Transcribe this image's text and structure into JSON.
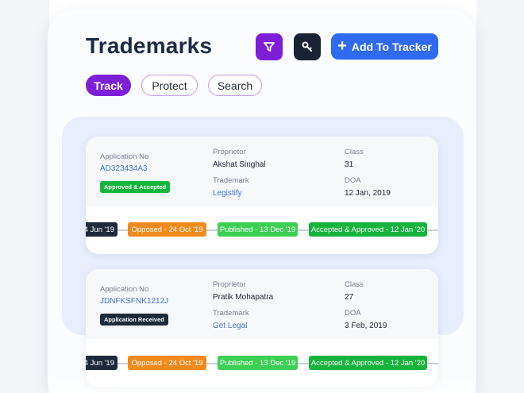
{
  "header": {
    "title": "Trademarks",
    "add_button_label": "Add To Tracker",
    "filter_icon": "filter-icon",
    "key_icon": "key-icon"
  },
  "tabs": [
    {
      "label": "Track",
      "active": true
    },
    {
      "label": "Protect",
      "active": false
    },
    {
      "label": "Search",
      "active": false
    }
  ],
  "labels": {
    "application_no": "Application No",
    "proprietor": "Proprietor",
    "class": "Class",
    "trademark": "Trademark",
    "doa": "DOA"
  },
  "records": [
    {
      "application_no": "AD323434A3",
      "status": "Approved & Accepted",
      "status_color": "#13b53d",
      "proprietor": "Akshat Singhal",
      "class": "31",
      "trademark": "Legistify",
      "doa": "12 Jan, 2019",
      "timeline": [
        "4 Jun '19",
        "Opposed - 24 Oct '19",
        "Published - 13 Dec '19",
        "Accepted & Approved - 12 Jan '20"
      ]
    },
    {
      "application_no": "JDNFKSFNK1212J",
      "status": "Application Received",
      "status_color": "#1e2a3a",
      "proprietor": "Pratik Mohapatra",
      "class": "27",
      "trademark": "Get Legal",
      "doa": "3 Feb, 2019",
      "timeline": [
        "4 Jun '19",
        "Opposed - 24 Oct '19",
        "Published - 13 Dec '19",
        "Accepted & Approved - 12 Jan '20"
      ]
    }
  ],
  "colors": {
    "accent_purple": "#7e1fd8",
    "primary_blue": "#2f6bf0",
    "dark": "#1a2233",
    "orange": "#f08a1c",
    "lime": "#3ccf54",
    "green": "#16b33d"
  }
}
